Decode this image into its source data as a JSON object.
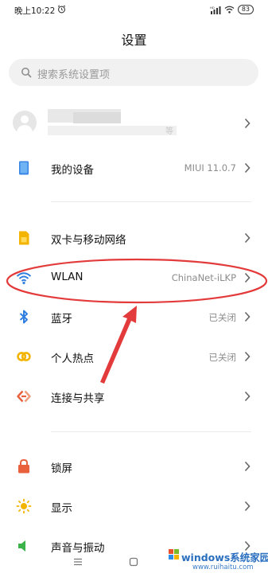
{
  "status_bar": {
    "time": "晚上10:22",
    "battery": "83"
  },
  "header": {
    "title": "设置"
  },
  "search": {
    "placeholder": "搜索系统设置项"
  },
  "account": {
    "subtitle_tail": "等"
  },
  "rows": [
    {
      "label": "我的设备",
      "value": "MIUI 11.0.7",
      "icon": "tablet-icon",
      "color": "#2f7fe0"
    },
    {
      "label": "双卡与移动网络",
      "value": "",
      "icon": "sim-card-icon",
      "color": "#f3b400"
    },
    {
      "label": "WLAN",
      "value": "ChinaNet-iLKP",
      "icon": "wifi-icon",
      "color": "#2f7fe0"
    },
    {
      "label": "蓝牙",
      "value": "已关闭",
      "icon": "bluetooth-icon",
      "color": "#2f7fe0"
    },
    {
      "label": "个人热点",
      "value": "已关闭",
      "icon": "hotspot-icon",
      "color": "#f3b400"
    },
    {
      "label": "连接与共享",
      "value": "",
      "icon": "share-icon",
      "color": "#e9603d"
    },
    {
      "label": "锁屏",
      "value": "",
      "icon": "lock-icon",
      "color": "#e9603d"
    },
    {
      "label": "显示",
      "value": "",
      "icon": "sun-icon",
      "color": "#f3b400"
    },
    {
      "label": "声音与振动",
      "value": "",
      "icon": "sound-icon",
      "color": "#3bb34a"
    }
  ],
  "annotation_color": "#e33b3b",
  "watermark": {
    "title": "windows系统家园",
    "url": "www.ruihaitu.com"
  }
}
